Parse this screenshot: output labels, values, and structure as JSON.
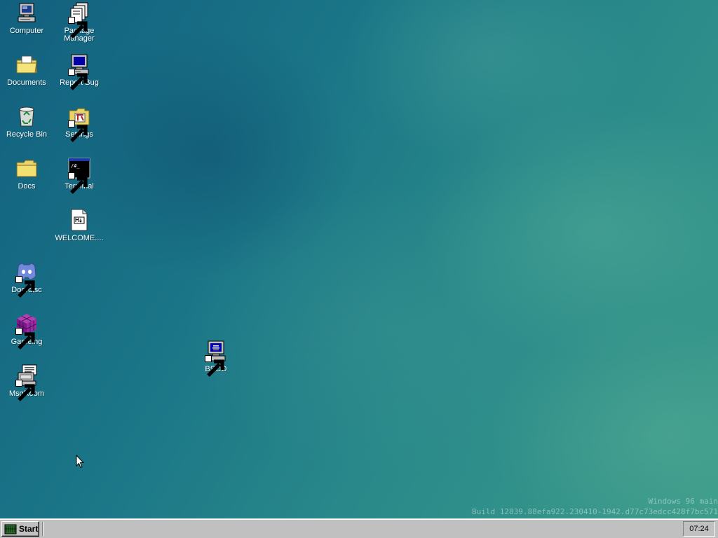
{
  "desktop": {
    "icons": {
      "computer": {
        "label": "Computer"
      },
      "package_manager": {
        "label": "Package Manager"
      },
      "documents": {
        "label": "Documents"
      },
      "report_bug": {
        "label": "Report Bug"
      },
      "recycle_bin": {
        "label": "Recycle Bin"
      },
      "settings": {
        "label": "Settings"
      },
      "docs": {
        "label": "Docs"
      },
      "terminal": {
        "label": "Terminal"
      },
      "welcome": {
        "label": "WELCOME...."
      },
      "doordisc": {
        "label": "Doordisc"
      },
      "gameing": {
        "label": "Gameing"
      },
      "msgroom": {
        "label": "MsgRoom"
      },
      "bsod": {
        "label": "BSOD"
      }
    }
  },
  "watermark": {
    "line1": "Windows 96 main",
    "line2": "Build 12839.88efa922.230410-1942.d77c73edcc428f7bc571"
  },
  "taskbar": {
    "start_label": "Start",
    "clock": "07:24"
  },
  "colors": {
    "taskbar": "#c0c0c0",
    "desktop_accent": "#1f7a86"
  }
}
